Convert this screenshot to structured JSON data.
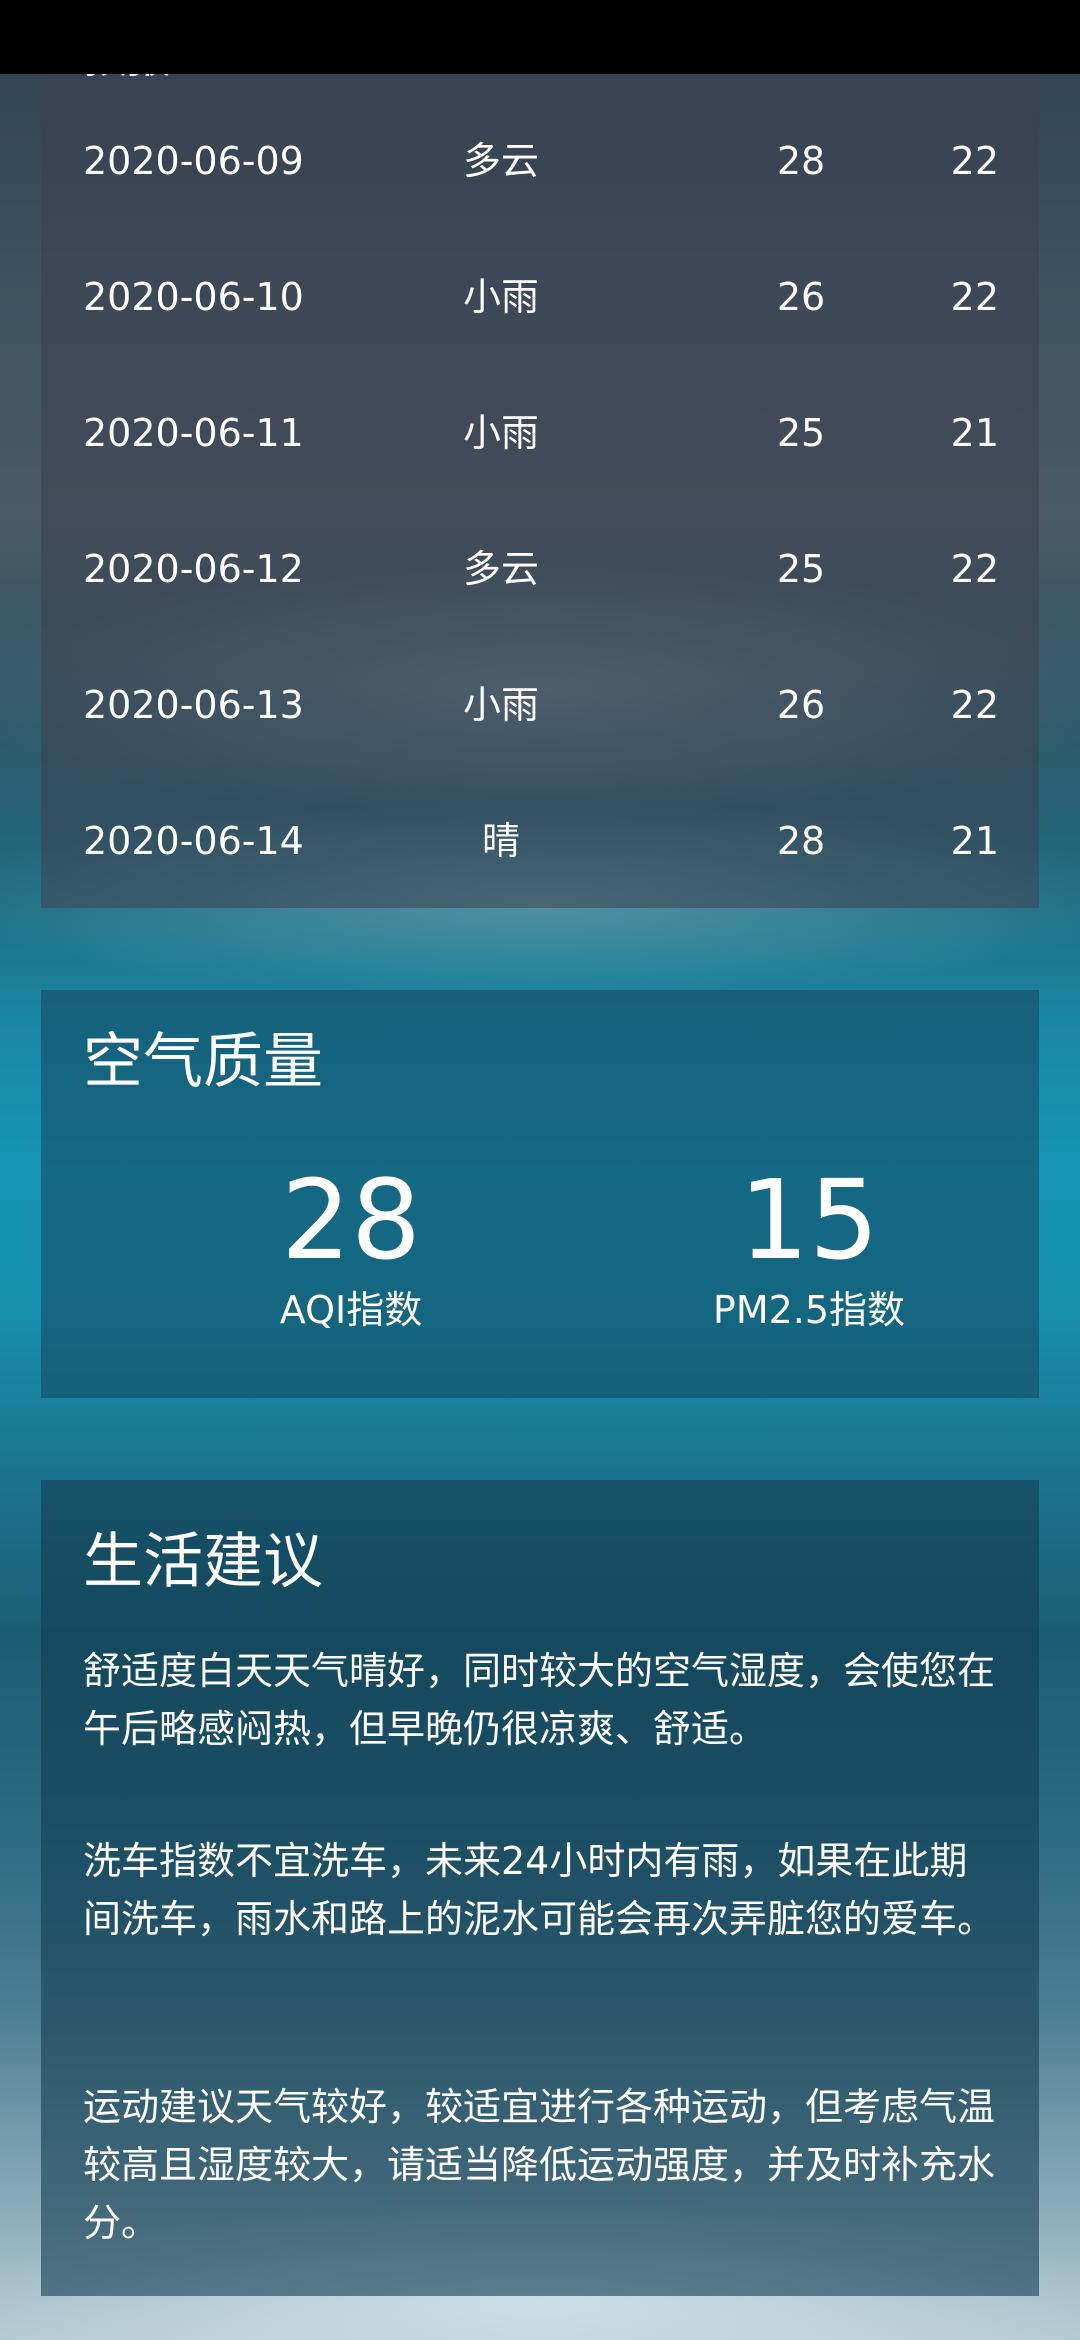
{
  "forecast": {
    "title": "预报",
    "rows": [
      {
        "date": "2020-06-09",
        "weather": "多云",
        "max": "28",
        "min": "22"
      },
      {
        "date": "2020-06-10",
        "weather": "小雨",
        "max": "26",
        "min": "22"
      },
      {
        "date": "2020-06-11",
        "weather": "小雨",
        "max": "25",
        "min": "21"
      },
      {
        "date": "2020-06-12",
        "weather": "多云",
        "max": "25",
        "min": "22"
      },
      {
        "date": "2020-06-13",
        "weather": "小雨",
        "max": "26",
        "min": "22"
      },
      {
        "date": "2020-06-14",
        "weather": "晴",
        "max": "28",
        "min": "21"
      }
    ]
  },
  "aqi": {
    "title": "空气质量",
    "aqi_value": "28",
    "aqi_label": "AQI指数",
    "pm25_value": "15",
    "pm25_label": "PM2.5指数"
  },
  "suggestion": {
    "title": "生活建议",
    "comfort": "舒适度白天天气晴好，同时较大的空气湿度，会使您在午后略感闷热，但早晚仍很凉爽、舒适。",
    "car_wash": "洗车指数不宜洗车，未来24小时内有雨，如果在此期间洗车，雨水和路上的泥水可能会再次弄脏您的爱车。",
    "sport": "运动建议天气较好，较适宜进行各种运动，但考虑气温较高且湿度较大，请适当降低运动强度，并及时补充水分。"
  }
}
